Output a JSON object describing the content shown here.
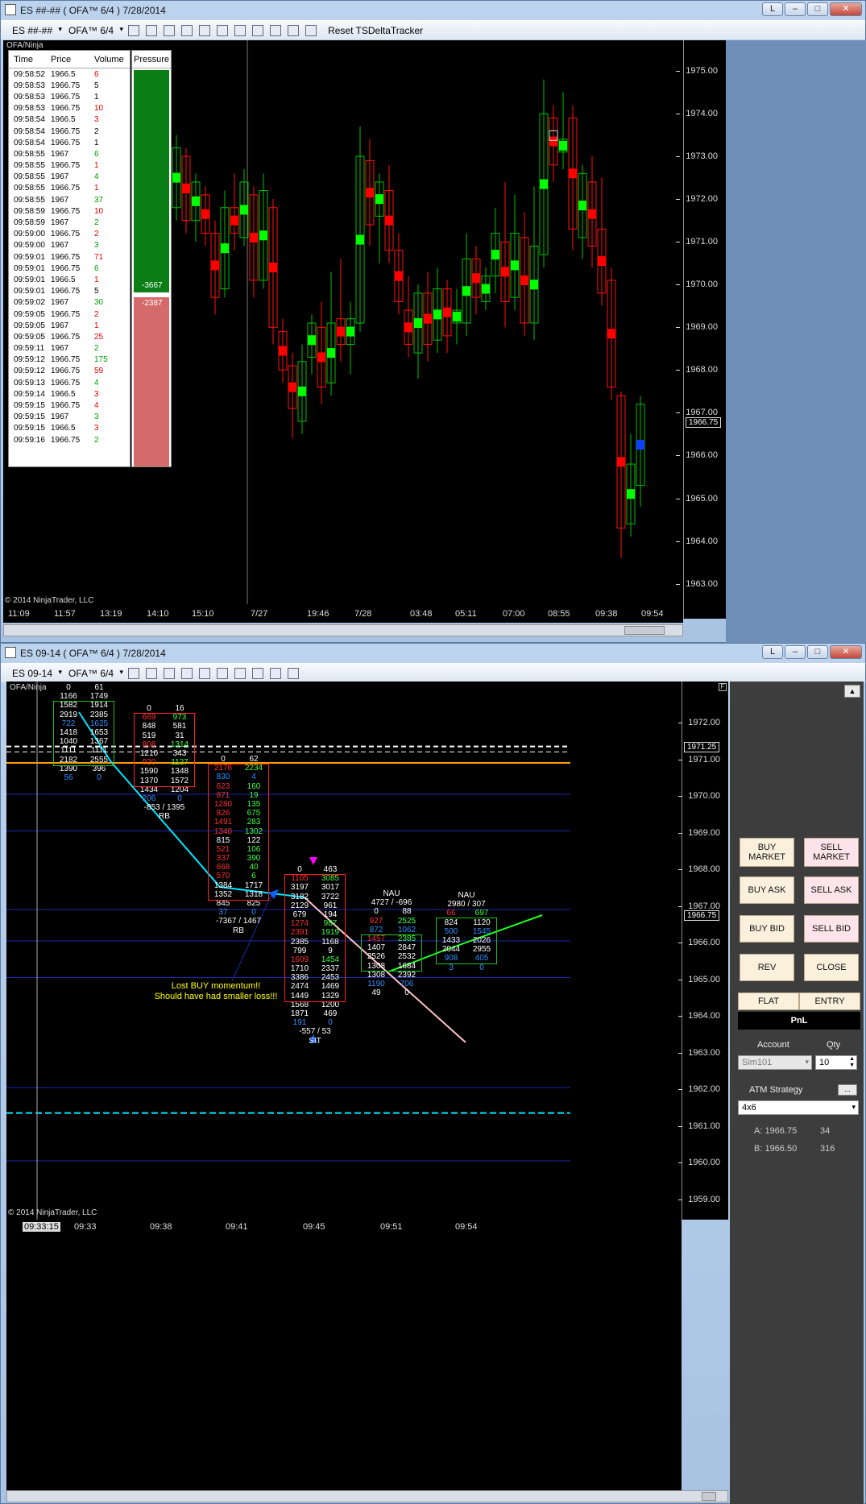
{
  "top_window": {
    "title": "ES ##-## ( OFA™ 6/4 )  7/28/2014",
    "win_buttons": [
      "L",
      "–",
      "□",
      "✕"
    ],
    "toolbar": {
      "instrument": "ES ##-##",
      "indicator": "OFA™ 6/4",
      "reset": "Reset TSDeltaTracker"
    },
    "label": "OFA/Ninja",
    "tape_headers": [
      "Time",
      "Price",
      "Volume"
    ],
    "pressure_header": "Pressure",
    "pressure_top": "-3667",
    "pressure_bottom": "-2387",
    "pressure_level": 0.56,
    "copyright": "© 2014 NinjaTrader, LLC",
    "y_ticks": [
      "1975.00",
      "1974.00",
      "1973.00",
      "1972.00",
      "1971.00",
      "1970.00",
      "1969.00",
      "1968.00",
      "1967.00",
      "1966.00",
      "1965.00",
      "1964.00",
      "1963.00"
    ],
    "current_price": "1966.75",
    "x_ticks": [
      "11:09",
      "11:57",
      "13:19",
      "14:10",
      "15:10",
      "7/27",
      "19:46",
      "7/28",
      "03:48",
      "05:11",
      "07:00",
      "08:55",
      "09:38",
      "09:54"
    ],
    "tape": [
      [
        "09:58:52",
        "1966.5",
        "6",
        "r"
      ],
      [
        "09:58:53",
        "1966.75",
        "5",
        "k"
      ],
      [
        "09:58:53",
        "1966.75",
        "1",
        "k"
      ],
      [
        "09:58:53",
        "1966.75",
        "10",
        "r"
      ],
      [
        "09:58:54",
        "1966.5",
        "3",
        "r"
      ],
      [
        "09:58:54",
        "1966.75",
        "2",
        "k"
      ],
      [
        "09:58:54",
        "1966.75",
        "1",
        "k"
      ],
      [
        "09:58:55",
        "1967",
        "6",
        "g"
      ],
      [
        "09:58:55",
        "1966.75",
        "1",
        "r"
      ],
      [
        "09:58:55",
        "1967",
        "4",
        "g"
      ],
      [
        "09:58:55",
        "1966.75",
        "1",
        "r"
      ],
      [
        "09:58:55",
        "1967",
        "37",
        "g"
      ],
      [
        "09:58:59",
        "1966.75",
        "10",
        "r"
      ],
      [
        "09:58:59",
        "1967",
        "2",
        "g"
      ],
      [
        "09:59:00",
        "1966.75",
        "2",
        "r"
      ],
      [
        "09:59:00",
        "1967",
        "3",
        "g"
      ],
      [
        "09:59:01",
        "1966.75",
        "71",
        "r"
      ],
      [
        "09:59:01",
        "1966.75",
        "6",
        "g"
      ],
      [
        "09:59:01",
        "1966.5",
        "1",
        "r"
      ],
      [
        "09:59:01",
        "1966.75",
        "5",
        "k"
      ],
      [
        "09:59:02",
        "1967",
        "30",
        "g"
      ],
      [
        "09:59:05",
        "1966.75",
        "2",
        "r"
      ],
      [
        "09:59:05",
        "1967",
        "1",
        "r"
      ],
      [
        "09:59:05",
        "1966.75",
        "25",
        "r"
      ],
      [
        "09:59:11",
        "1967",
        "2",
        "g"
      ],
      [
        "09:59:12",
        "1966.75",
        "175",
        "g"
      ],
      [
        "09:59:12",
        "1966.75",
        "59",
        "r"
      ],
      [
        "09:59:13",
        "1966.75",
        "4",
        "g"
      ],
      [
        "09:59:14",
        "1966.5",
        "3",
        "r"
      ],
      [
        "09:59:15",
        "1966.75",
        "4",
        "r"
      ],
      [
        "09:59:15",
        "1967",
        "3",
        "g"
      ],
      [
        "09:59:15",
        "1966.5",
        "3",
        "r"
      ],
      [
        "09:59:16",
        "1966.75",
        "2",
        "g"
      ]
    ]
  },
  "bottom_window": {
    "title": "ES 09-14 ( OFA™ 6/4 )  7/28/2014",
    "win_buttons": [
      "L",
      "–",
      "□",
      "✕"
    ],
    "toolbar": {
      "instrument": "ES 09-14",
      "indicator": "OFA™ 6/4"
    },
    "label": "OFA/Ninja",
    "copyright": "© 2014 NinjaTrader, LLC",
    "f_marker": "F",
    "y_ticks": [
      "1972.00",
      "1971.00",
      "1970.00",
      "1969.00",
      "1968.00",
      "1967.00",
      "1966.00",
      "1965.00",
      "1964.00",
      "1963.00",
      "1962.00",
      "1961.00",
      "1960.00",
      "1959.00"
    ],
    "price_flags": [
      "1971.25",
      "1966.75"
    ],
    "x_ticks": [
      "09:33:15",
      "09:33",
      "09:38",
      "09:41",
      "09:45",
      "09:51",
      "09:54"
    ],
    "annotation_line1": "Lost BUY momentum!!",
    "annotation_line2": "Should have had smaller loss!!!",
    "footprints": [
      {
        "summary": "",
        "tag": "",
        "rows": [
          [
            "0",
            "61"
          ],
          [
            "1166",
            "1749"
          ],
          [
            "1582",
            "1914"
          ],
          [
            "2919",
            "2385"
          ],
          [
            "722",
            "1625"
          ],
          [
            "1418",
            "1653"
          ],
          [
            "1040",
            "1367"
          ],
          [
            "1111",
            "1111"
          ],
          [
            "2182",
            "2555"
          ],
          [
            "1390",
            "396"
          ],
          [
            "56",
            "0"
          ]
        ]
      },
      {
        "summary": "-853 / 1395",
        "tag": "RB",
        "rows": [
          [
            "0",
            "16"
          ],
          [
            "669",
            "973"
          ],
          [
            "848",
            "581"
          ],
          [
            "519",
            "31"
          ],
          [
            "808",
            "1314"
          ],
          [
            "1210",
            "343"
          ],
          [
            "920",
            "1127"
          ],
          [
            "1590",
            "1348"
          ],
          [
            "1370",
            "1572"
          ],
          [
            "1434",
            "1204"
          ],
          [
            "206",
            "0"
          ]
        ]
      },
      {
        "summary": "-7367 / 1467",
        "tag": "RB",
        "rows": [
          [
            "0",
            "62"
          ],
          [
            "2176",
            "2234"
          ],
          [
            "830",
            "4"
          ],
          [
            "623",
            "160"
          ],
          [
            "871",
            "19"
          ],
          [
            "1280",
            "135"
          ],
          [
            "826",
            "675"
          ],
          [
            "1491",
            "283"
          ],
          [
            "1340",
            "1302"
          ],
          [
            "815",
            "122"
          ],
          [
            "521",
            "106"
          ],
          [
            "337",
            "390"
          ],
          [
            "668",
            "40"
          ],
          [
            "570",
            "6"
          ],
          [
            "1384",
            "1717"
          ],
          [
            "1352",
            "1318"
          ],
          [
            "845",
            "825"
          ],
          [
            "37",
            "0"
          ]
        ]
      },
      {
        "summary": "-557 / 53",
        "tag": "SIT",
        "rows": [
          [
            "0",
            "463"
          ],
          [
            "1105",
            "3085"
          ],
          [
            "3197",
            "3017"
          ],
          [
            "3182",
            "3722"
          ],
          [
            "2129",
            "961"
          ],
          [
            "679",
            "194"
          ],
          [
            "1274",
            "987"
          ],
          [
            "2391",
            "1919"
          ],
          [
            "2385",
            "1168"
          ],
          [
            "799",
            "9"
          ],
          [
            "1609",
            "1454"
          ],
          [
            "1710",
            "2337"
          ],
          [
            "3386",
            "2453"
          ],
          [
            "2474",
            "1469"
          ],
          [
            "1449",
            "1329"
          ],
          [
            "1568",
            "1200"
          ],
          [
            "1871",
            "469"
          ],
          [
            "191",
            "0"
          ]
        ]
      },
      {
        "summary": "4727 / -696",
        "tag": "NAU",
        "rows": [
          [
            "0",
            "88"
          ],
          [
            "927",
            "2525"
          ],
          [
            "872",
            "1062"
          ],
          [
            "1457",
            "2385"
          ],
          [
            "1407",
            "2847"
          ],
          [
            "2526",
            "2532"
          ],
          [
            "1308",
            "1684"
          ],
          [
            "1308",
            "2392"
          ],
          [
            "1190",
            "706"
          ],
          [
            "49",
            "0"
          ]
        ]
      },
      {
        "summary": "2980 / 307",
        "tag": "NAU",
        "rows": [
          [
            "66",
            "697"
          ],
          [
            "824",
            "1120"
          ],
          [
            "500",
            "1545"
          ],
          [
            "1433",
            "2026"
          ],
          [
            "2044",
            "2955"
          ],
          [
            "908",
            "405"
          ],
          [
            "3",
            "0"
          ]
        ]
      }
    ]
  },
  "order_panel": {
    "buy_market": "BUY MARKET",
    "sell_market": "SELL MARKET",
    "buy_ask": "BUY ASK",
    "sell_ask": "SELL ASK",
    "buy_bid": "BUY BID",
    "sell_bid": "SELL BID",
    "rev": "REV",
    "close": "CLOSE",
    "flat": "FLAT",
    "entry": "ENTRY",
    "pnl": "PnL",
    "account_label": "Account",
    "qty_label": "Qty",
    "account": "Sim101",
    "qty": "10",
    "atm_label": "ATM Strategy",
    "atm_button": "...",
    "atm_value": "4x6",
    "ask_label": "A: 1966.75",
    "ask_size": "34",
    "bid_label": "B: 1966.50",
    "bid_size": "316"
  },
  "colors": {
    "bull": "#00c000",
    "bear": "#e00000",
    "blue": "#1060ff",
    "accent": "#ff9900",
    "cyan": "#00e5ff"
  }
}
